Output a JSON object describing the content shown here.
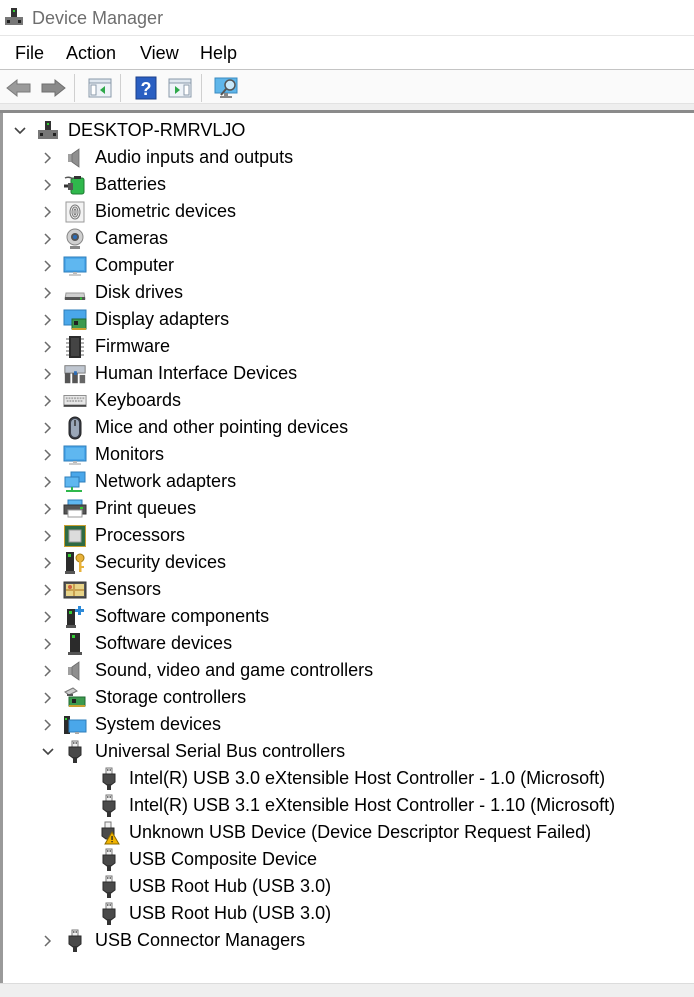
{
  "window": {
    "title": "Device Manager"
  },
  "menu": [
    "File",
    "Action",
    "View",
    "Help"
  ],
  "toolbar": {
    "buttons": [
      {
        "name": "back",
        "icon": "back-arrow-icon"
      },
      {
        "name": "forward",
        "icon": "forward-arrow-icon"
      },
      {
        "name": "show-hide-console-tree",
        "icon": "console-tree-icon"
      },
      {
        "name": "help",
        "icon": "help-icon"
      },
      {
        "name": "show-hide-action-pane",
        "icon": "action-pane-icon"
      },
      {
        "name": "scan-hardware-changes",
        "icon": "scan-monitor-icon"
      }
    ]
  },
  "tree": {
    "root": {
      "label": "DESKTOP-RMRVLJO",
      "expanded": true,
      "icon": "computer-root-icon"
    },
    "categories": [
      {
        "label": "Audio inputs and outputs",
        "icon": "speaker-icon",
        "expanded": false
      },
      {
        "label": "Batteries",
        "icon": "battery-icon",
        "expanded": false
      },
      {
        "label": "Biometric devices",
        "icon": "fingerprint-icon",
        "expanded": false
      },
      {
        "label": "Cameras",
        "icon": "webcam-icon",
        "expanded": false
      },
      {
        "label": "Computer",
        "icon": "monitor-icon",
        "expanded": false
      },
      {
        "label": "Disk drives",
        "icon": "disk-drive-icon",
        "expanded": false
      },
      {
        "label": "Display adapters",
        "icon": "display-adapter-icon",
        "expanded": false
      },
      {
        "label": "Firmware",
        "icon": "chip-icon",
        "expanded": false
      },
      {
        "label": "Human Interface Devices",
        "icon": "hid-icon",
        "expanded": false
      },
      {
        "label": "Keyboards",
        "icon": "keyboard-icon",
        "expanded": false
      },
      {
        "label": "Mice and other pointing devices",
        "icon": "mouse-icon",
        "expanded": false
      },
      {
        "label": "Monitors",
        "icon": "monitor-icon",
        "expanded": false
      },
      {
        "label": "Network adapters",
        "icon": "network-icon",
        "expanded": false
      },
      {
        "label": "Print queues",
        "icon": "printer-icon",
        "expanded": false
      },
      {
        "label": "Processors",
        "icon": "processor-icon",
        "expanded": false
      },
      {
        "label": "Security devices",
        "icon": "security-key-icon",
        "expanded": false
      },
      {
        "label": "Sensors",
        "icon": "sensor-icon",
        "expanded": false
      },
      {
        "label": "Software components",
        "icon": "software-component-icon",
        "expanded": false
      },
      {
        "label": "Software devices",
        "icon": "software-device-icon",
        "expanded": false
      },
      {
        "label": "Sound, video and game controllers",
        "icon": "speaker-icon",
        "expanded": false
      },
      {
        "label": "Storage controllers",
        "icon": "storage-controller-icon",
        "expanded": false
      },
      {
        "label": "System devices",
        "icon": "system-devices-icon",
        "expanded": false
      },
      {
        "label": "Universal Serial Bus controllers",
        "icon": "usb-icon",
        "expanded": true,
        "children": [
          {
            "label": "Intel(R) USB 3.0 eXtensible Host Controller - 1.0 (Microsoft)",
            "icon": "usb-icon"
          },
          {
            "label": "Intel(R) USB 3.1 eXtensible Host Controller - 1.10 (Microsoft)",
            "icon": "usb-icon"
          },
          {
            "label": "Unknown USB Device (Device Descriptor Request Failed)",
            "icon": "usb-warning-icon",
            "status": "warning"
          },
          {
            "label": "USB Composite Device",
            "icon": "usb-icon"
          },
          {
            "label": "USB Root Hub (USB 3.0)",
            "icon": "usb-icon"
          },
          {
            "label": "USB Root Hub (USB 3.0)",
            "icon": "usb-icon"
          }
        ]
      },
      {
        "label": "USB Connector Managers",
        "icon": "usb-icon",
        "expanded": false
      }
    ]
  },
  "colors": {
    "title_text": "#6e6e6e",
    "chevron": "#6b6b6b",
    "warning": "#f2b400"
  }
}
